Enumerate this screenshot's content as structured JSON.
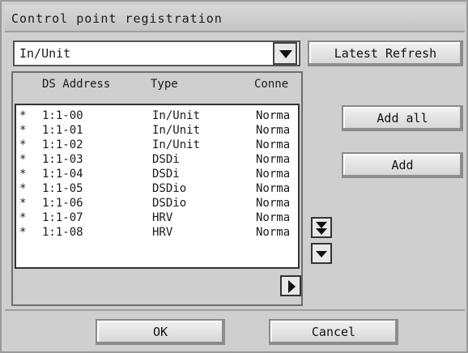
{
  "window": {
    "title": "Control point registration"
  },
  "filter": {
    "selected": "In/Unit"
  },
  "buttons": {
    "latest_refresh": "Latest Refresh",
    "add_all": "Add all",
    "add": "Add",
    "ok": "OK",
    "cancel": "Cancel"
  },
  "list": {
    "columns": [
      "DS Address",
      "Type",
      "Conne"
    ],
    "rows": [
      {
        "marker": "*",
        "address": "1:1-00",
        "type": "In/Unit",
        "conn": "Norma"
      },
      {
        "marker": "*",
        "address": "1:1-01",
        "type": "In/Unit",
        "conn": "Norma"
      },
      {
        "marker": "*",
        "address": "1:1-02",
        "type": "In/Unit",
        "conn": "Norma"
      },
      {
        "marker": "*",
        "address": "1:1-03",
        "type": "DSDi",
        "conn": "Norma"
      },
      {
        "marker": "*",
        "address": "1:1-04",
        "type": "DSDi",
        "conn": "Norma"
      },
      {
        "marker": "*",
        "address": "1:1-05",
        "type": "DSDio",
        "conn": "Norma"
      },
      {
        "marker": "*",
        "address": "1:1-06",
        "type": "DSDio",
        "conn": "Norma"
      },
      {
        "marker": "*",
        "address": "1:1-07",
        "type": "HRV",
        "conn": "Norma"
      },
      {
        "marker": "*",
        "address": "1:1-08",
        "type": "HRV",
        "conn": "Norma"
      }
    ]
  },
  "icons": {
    "combo_arrow": "chevron-down-icon",
    "page_down": "double-chevron-down-icon",
    "scroll_down": "chevron-down-icon",
    "scroll_right": "chevron-right-icon"
  }
}
